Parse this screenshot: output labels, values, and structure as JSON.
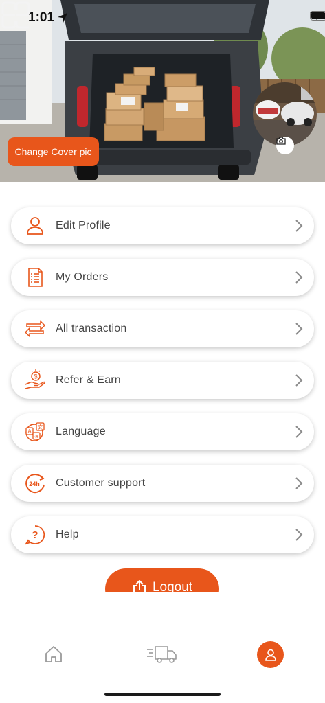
{
  "status_bar": {
    "time": "1:01"
  },
  "cover": {
    "change_label": "Change Cover pic"
  },
  "menu": [
    {
      "id": "edit-profile",
      "label": "Edit Profile",
      "icon": "user-icon"
    },
    {
      "id": "my-orders",
      "label": "My Orders",
      "icon": "order-list-icon"
    },
    {
      "id": "all-transaction",
      "label": "All transaction",
      "icon": "transfer-arrows-icon"
    },
    {
      "id": "refer-earn",
      "label": "Refer & Earn",
      "icon": "hand-coin-icon"
    },
    {
      "id": "language",
      "label": "Language",
      "icon": "language-icon"
    },
    {
      "id": "customer-support",
      "label": "Customer support",
      "icon": "support-24h-icon"
    },
    {
      "id": "help",
      "label": "Help",
      "icon": "help-question-icon"
    }
  ],
  "logout": {
    "label": "Logout",
    "icon": "logout-icon"
  },
  "bottom_nav": [
    {
      "id": "home",
      "icon": "home-icon",
      "active": false
    },
    {
      "id": "delivery",
      "icon": "truck-icon",
      "active": false
    },
    {
      "id": "profile",
      "icon": "profile-icon",
      "active": true
    }
  ],
  "colors": {
    "accent": "#e8561b",
    "text": "#444444",
    "nav_inactive": "#9a9a9a"
  }
}
